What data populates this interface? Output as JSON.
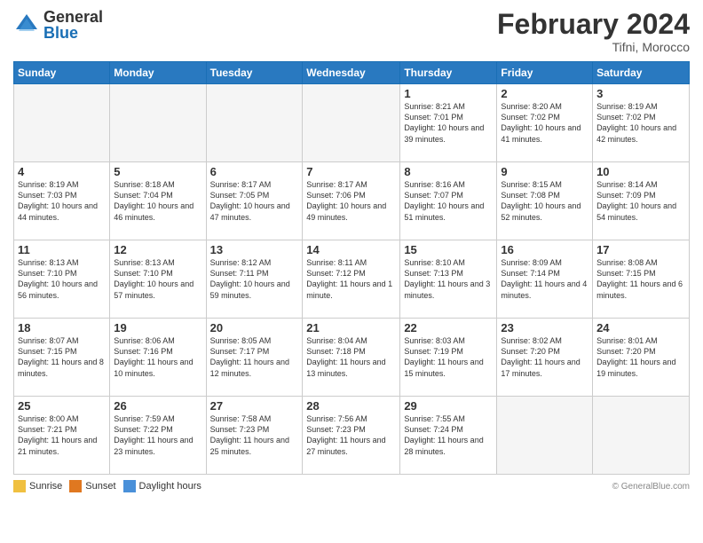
{
  "header": {
    "logo_general": "General",
    "logo_blue": "Blue",
    "month_title": "February 2024",
    "location": "Tifni, Morocco"
  },
  "weekdays": [
    "Sunday",
    "Monday",
    "Tuesday",
    "Wednesday",
    "Thursday",
    "Friday",
    "Saturday"
  ],
  "weeks": [
    [
      {
        "day": "",
        "empty": true
      },
      {
        "day": "",
        "empty": true
      },
      {
        "day": "",
        "empty": true
      },
      {
        "day": "",
        "empty": true
      },
      {
        "day": "1",
        "sunrise": "8:21 AM",
        "sunset": "7:01 PM",
        "daylight": "10 hours and 39 minutes."
      },
      {
        "day": "2",
        "sunrise": "8:20 AM",
        "sunset": "7:02 PM",
        "daylight": "10 hours and 41 minutes."
      },
      {
        "day": "3",
        "sunrise": "8:19 AM",
        "sunset": "7:02 PM",
        "daylight": "10 hours and 42 minutes."
      }
    ],
    [
      {
        "day": "4",
        "sunrise": "8:19 AM",
        "sunset": "7:03 PM",
        "daylight": "10 hours and 44 minutes."
      },
      {
        "day": "5",
        "sunrise": "8:18 AM",
        "sunset": "7:04 PM",
        "daylight": "10 hours and 46 minutes."
      },
      {
        "day": "6",
        "sunrise": "8:17 AM",
        "sunset": "7:05 PM",
        "daylight": "10 hours and 47 minutes."
      },
      {
        "day": "7",
        "sunrise": "8:17 AM",
        "sunset": "7:06 PM",
        "daylight": "10 hours and 49 minutes."
      },
      {
        "day": "8",
        "sunrise": "8:16 AM",
        "sunset": "7:07 PM",
        "daylight": "10 hours and 51 minutes."
      },
      {
        "day": "9",
        "sunrise": "8:15 AM",
        "sunset": "7:08 PM",
        "daylight": "10 hours and 52 minutes."
      },
      {
        "day": "10",
        "sunrise": "8:14 AM",
        "sunset": "7:09 PM",
        "daylight": "10 hours and 54 minutes."
      }
    ],
    [
      {
        "day": "11",
        "sunrise": "8:13 AM",
        "sunset": "7:10 PM",
        "daylight": "10 hours and 56 minutes."
      },
      {
        "day": "12",
        "sunrise": "8:13 AM",
        "sunset": "7:10 PM",
        "daylight": "10 hours and 57 minutes."
      },
      {
        "day": "13",
        "sunrise": "8:12 AM",
        "sunset": "7:11 PM",
        "daylight": "10 hours and 59 minutes."
      },
      {
        "day": "14",
        "sunrise": "8:11 AM",
        "sunset": "7:12 PM",
        "daylight": "11 hours and 1 minute."
      },
      {
        "day": "15",
        "sunrise": "8:10 AM",
        "sunset": "7:13 PM",
        "daylight": "11 hours and 3 minutes."
      },
      {
        "day": "16",
        "sunrise": "8:09 AM",
        "sunset": "7:14 PM",
        "daylight": "11 hours and 4 minutes."
      },
      {
        "day": "17",
        "sunrise": "8:08 AM",
        "sunset": "7:15 PM",
        "daylight": "11 hours and 6 minutes."
      }
    ],
    [
      {
        "day": "18",
        "sunrise": "8:07 AM",
        "sunset": "7:15 PM",
        "daylight": "11 hours and 8 minutes."
      },
      {
        "day": "19",
        "sunrise": "8:06 AM",
        "sunset": "7:16 PM",
        "daylight": "11 hours and 10 minutes."
      },
      {
        "day": "20",
        "sunrise": "8:05 AM",
        "sunset": "7:17 PM",
        "daylight": "11 hours and 12 minutes."
      },
      {
        "day": "21",
        "sunrise": "8:04 AM",
        "sunset": "7:18 PM",
        "daylight": "11 hours and 13 minutes."
      },
      {
        "day": "22",
        "sunrise": "8:03 AM",
        "sunset": "7:19 PM",
        "daylight": "11 hours and 15 minutes."
      },
      {
        "day": "23",
        "sunrise": "8:02 AM",
        "sunset": "7:20 PM",
        "daylight": "11 hours and 17 minutes."
      },
      {
        "day": "24",
        "sunrise": "8:01 AM",
        "sunset": "7:20 PM",
        "daylight": "11 hours and 19 minutes."
      }
    ],
    [
      {
        "day": "25",
        "sunrise": "8:00 AM",
        "sunset": "7:21 PM",
        "daylight": "11 hours and 21 minutes."
      },
      {
        "day": "26",
        "sunrise": "7:59 AM",
        "sunset": "7:22 PM",
        "daylight": "11 hours and 23 minutes."
      },
      {
        "day": "27",
        "sunrise": "7:58 AM",
        "sunset": "7:23 PM",
        "daylight": "11 hours and 25 minutes."
      },
      {
        "day": "28",
        "sunrise": "7:56 AM",
        "sunset": "7:23 PM",
        "daylight": "11 hours and 27 minutes."
      },
      {
        "day": "29",
        "sunrise": "7:55 AM",
        "sunset": "7:24 PM",
        "daylight": "11 hours and 28 minutes."
      },
      {
        "day": "",
        "empty": true
      },
      {
        "day": "",
        "empty": true
      }
    ]
  ],
  "footer": {
    "sunrise_label": "Sunrise",
    "sunset_label": "Sunset",
    "daylight_label": "Daylight hours",
    "source": "© GeneralBlue.com"
  }
}
